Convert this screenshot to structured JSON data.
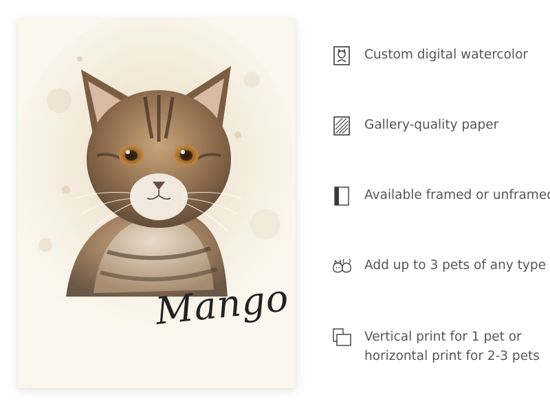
{
  "print": {
    "pet_name": "Mango",
    "paper_color": "#fbf7ee",
    "wash_color": "#e8dcc6"
  },
  "features": [
    {
      "icon": "pet-portrait-icon",
      "lines": [
        "Custom digital watercolor"
      ]
    },
    {
      "icon": "paper-texture-icon",
      "lines": [
        "Gallery-quality paper"
      ]
    },
    {
      "icon": "frame-icon",
      "lines": [
        "Available framed or unframed"
      ]
    },
    {
      "icon": "pets-icon",
      "lines": [
        "Add up to 3 pets of any type"
      ]
    },
    {
      "icon": "orientation-icon",
      "lines": [
        "Vertical print for 1 pet or",
        "horizontal print for 2-3 pets"
      ]
    }
  ],
  "colors": {
    "text": "#555555",
    "icon": "#3a3a3a"
  }
}
